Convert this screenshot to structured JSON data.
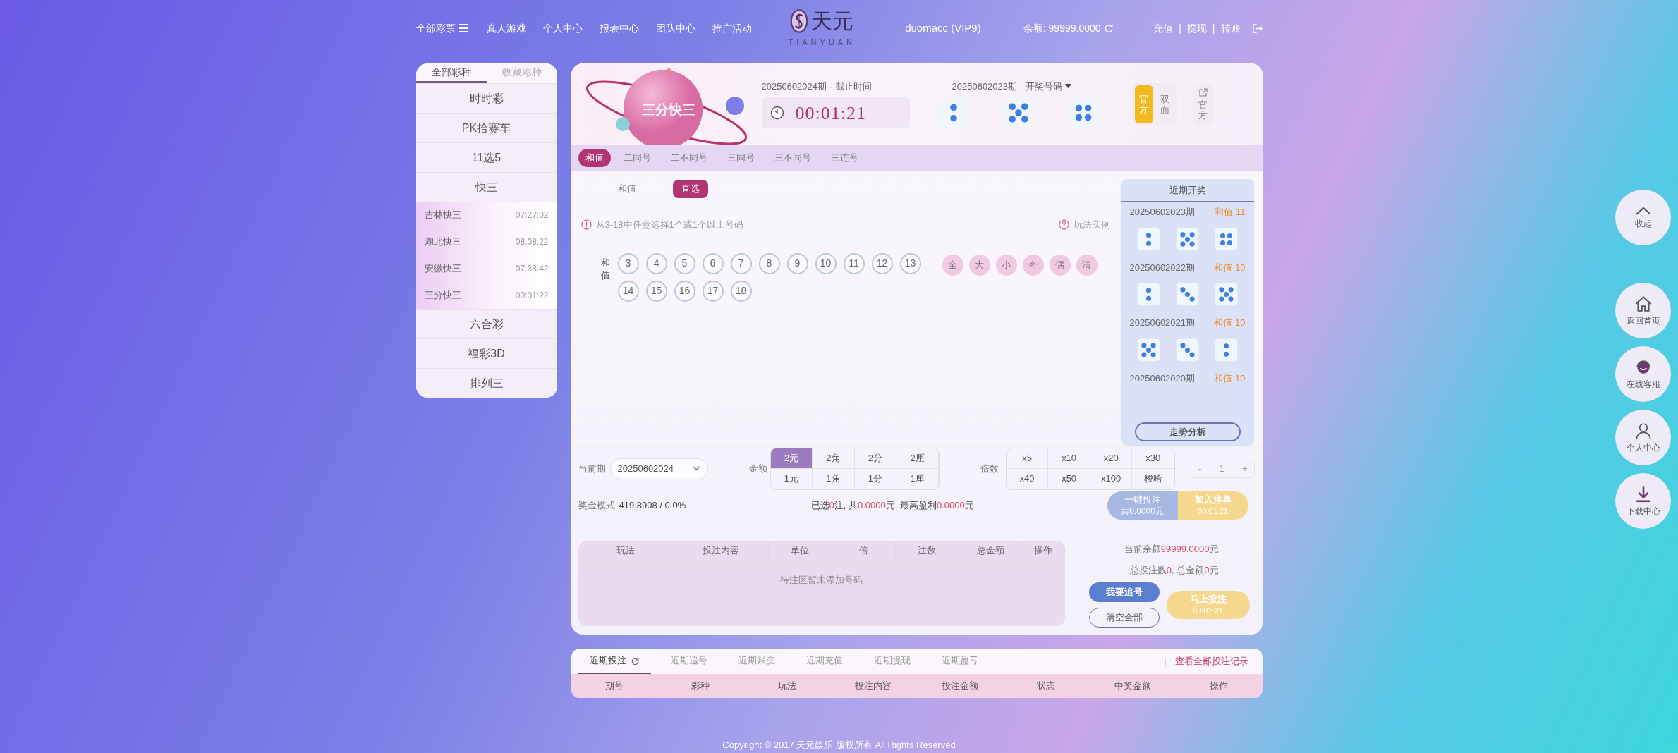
{
  "nav": {
    "items": [
      {
        "label": "全部彩票",
        "kind": "menu"
      },
      {
        "label": "真人游戏",
        "kind": "plain"
      },
      {
        "label": "个人中心",
        "kind": "plain"
      },
      {
        "label": "报表中心",
        "kind": "plain"
      },
      {
        "label": "团队中心",
        "kind": "plain"
      },
      {
        "label": "推广活动",
        "kind": "plain"
      }
    ],
    "logo": {
      "name": "天元",
      "sub": "TIANYUAN"
    },
    "user": "duomacc (VIP9)",
    "balance_label": "余额:",
    "balance": "99999.0000",
    "links": [
      "充值",
      "提现",
      "转账"
    ],
    "link_separator": "|"
  },
  "sidebar": {
    "tabs": [
      {
        "label": "全部彩种",
        "selected": true
      },
      {
        "label": "收藏彩种",
        "selected": false
      }
    ],
    "groups": [
      {
        "label": "时时彩"
      },
      {
        "label": "PK拾赛车"
      },
      {
        "label": "11选5"
      },
      {
        "label": "快三",
        "children": [
          {
            "name": "吉林快三",
            "time": "07:27:02"
          },
          {
            "name": "湖北快三",
            "time": "08:08:22"
          },
          {
            "name": "安徽快三",
            "time": "07:38:42"
          },
          {
            "name": "三分快三",
            "time": "00:01:22"
          }
        ]
      },
      {
        "label": "六合彩"
      },
      {
        "label": "福彩3D"
      },
      {
        "label": "排列三"
      }
    ]
  },
  "game": {
    "name": "三分快三",
    "current_issue": "20250602024期 · 截止时间",
    "countdown": "00:01:21",
    "last_issue": "20250602023期 · 开奖号码",
    "last_dice": [
      {
        "kind": "two"
      },
      {
        "kind": "five"
      },
      {
        "kind": "four"
      }
    ],
    "modes": [
      {
        "label": "官方",
        "selected": true
      },
      {
        "label": "双面",
        "selected": false
      }
    ],
    "official_link": "官方"
  },
  "play_tabs": [
    {
      "label": "和值",
      "selected": true
    },
    {
      "label": "二同号",
      "selected": false
    },
    {
      "label": "二不同号",
      "selected": false
    },
    {
      "label": "三同号",
      "selected": false
    },
    {
      "label": "三不同号",
      "selected": false
    },
    {
      "label": "三连号",
      "selected": false
    }
  ],
  "sub_tabs": [
    {
      "label": "和值",
      "selected": false
    },
    {
      "label": "直选",
      "selected": true
    }
  ],
  "hint": "从3-18中任意选择1个或1个以上号码",
  "example_link": "玩法实例",
  "row_label": "和值",
  "numbers": [
    {
      "label": "3",
      "selected": false
    },
    {
      "label": "4",
      "selected": false
    },
    {
      "label": "5",
      "selected": false
    },
    {
      "label": "6",
      "selected": false
    },
    {
      "label": "7",
      "selected": false
    },
    {
      "label": "8",
      "selected": false
    },
    {
      "label": "9",
      "selected": false
    },
    {
      "label": "10",
      "selected": false
    },
    {
      "label": "11",
      "selected": false
    },
    {
      "label": "12",
      "selected": false
    },
    {
      "label": "13",
      "selected": false
    },
    {
      "label": "14",
      "selected": false
    },
    {
      "label": "15",
      "selected": false
    },
    {
      "label": "16",
      "selected": false
    },
    {
      "label": "17",
      "selected": false
    },
    {
      "label": "18",
      "selected": false
    }
  ],
  "quick_picks": [
    "全",
    "大",
    "小",
    "奇",
    "偶",
    "清"
  ],
  "recent": {
    "title": "近期开奖",
    "draws": [
      {
        "issue": "20250602023期",
        "sum": "和值 11",
        "dice": [
          {
            "kind": "two"
          },
          {
            "kind": "five"
          },
          {
            "kind": "four"
          }
        ]
      },
      {
        "issue": "20250602022期",
        "sum": "和值 10",
        "dice": [
          {
            "kind": "two"
          },
          {
            "kind": "three"
          },
          {
            "kind": "five"
          }
        ]
      },
      {
        "issue": "20250602021期",
        "sum": "和值 10",
        "dice": [
          {
            "kind": "five"
          },
          {
            "kind": "three"
          },
          {
            "kind": "two"
          }
        ]
      },
      {
        "issue": "20250602020期",
        "sum": "和值 10"
      }
    ],
    "button": "走势分析"
  },
  "controls": {
    "issue_label": "当前期",
    "issue_value": "20250602024",
    "amount_label": "金额",
    "amounts": [
      {
        "label": "2元",
        "selected": true
      },
      {
        "label": "2角",
        "selected": false
      },
      {
        "label": "2分",
        "selected": false
      },
      {
        "label": "2厘",
        "selected": false
      },
      {
        "label": "1元",
        "selected": false
      },
      {
        "label": "1角",
        "selected": false
      },
      {
        "label": "1分",
        "selected": false
      },
      {
        "label": "1厘",
        "selected": false
      }
    ],
    "multiplier_label": "倍数",
    "multipliers": [
      "x5",
      "x10",
      "x20",
      "x30",
      "x40",
      "x50",
      "x100",
      "梭哈"
    ],
    "stepper": {
      "minus": "-",
      "value": "1",
      "plus": "+"
    }
  },
  "prize": {
    "label": "奖金模式",
    "value": "419.8908 / 0.0%"
  },
  "summary": [
    {
      "text": "已选",
      "kind": "plain"
    },
    {
      "text": "0",
      "kind": "value"
    },
    {
      "text": "注, 共",
      "kind": "plain"
    },
    {
      "text": "0.0000",
      "kind": "value"
    },
    {
      "text": "元, 最高盈利",
      "kind": "plain"
    },
    {
      "text": "0.0000",
      "kind": "value"
    },
    {
      "text": "元",
      "kind": "plain"
    }
  ],
  "quick_bet": {
    "label": "一键投注",
    "sub": "共0.0000元"
  },
  "add_order": {
    "label": "加入注单",
    "sub": "00:01:21"
  },
  "bet_table": {
    "columns": [
      "玩法",
      "投注内容",
      "单位",
      "倍",
      "注数",
      "总金额",
      "操作"
    ],
    "empty": "待注区暂未添加号码"
  },
  "account": {
    "balance": [
      {
        "text": "当前余额",
        "kind": "plain"
      },
      {
        "text": "99999.0000",
        "kind": "value"
      },
      {
        "text": "元",
        "kind": "plain"
      }
    ],
    "totals": [
      {
        "text": "总投注数",
        "kind": "plain"
      },
      {
        "text": "0",
        "kind": "value"
      },
      {
        "text": ", 总金额",
        "kind": "plain"
      },
      {
        "text": "0",
        "kind": "value"
      },
      {
        "text": "元",
        "kind": "plain"
      }
    ]
  },
  "chase_button": "我要追号",
  "clear_button": "清空全部",
  "bet_now": {
    "label": "马上投注",
    "sub": "00:01:21"
  },
  "records": {
    "tabs": [
      {
        "label": "近期投注",
        "selected": true
      },
      {
        "label": "近期追号",
        "selected": false
      },
      {
        "label": "近期账变",
        "selected": false
      },
      {
        "label": "近期充值",
        "selected": false
      },
      {
        "label": "近期提现",
        "selected": false
      },
      {
        "label": "近期盈亏",
        "selected": false
      }
    ],
    "separator": "|",
    "link": "查看全部投注记录",
    "columns": [
      "期号",
      "彩种",
      "玩法",
      "投注内容",
      "投注金额",
      "状态",
      "中奖金额",
      "操作"
    ]
  },
  "footer": "Copyright © 2017 天元娱乐 版权所有 All Rights Reserved",
  "float_buttons": [
    {
      "label": "收起",
      "kind": "collapse"
    },
    {
      "label": "返回首页",
      "kind": "home"
    },
    {
      "label": "在线客服",
      "kind": "support"
    },
    {
      "label": "个人中心",
      "kind": "user"
    },
    {
      "label": "下载中心",
      "kind": "download"
    }
  ]
}
